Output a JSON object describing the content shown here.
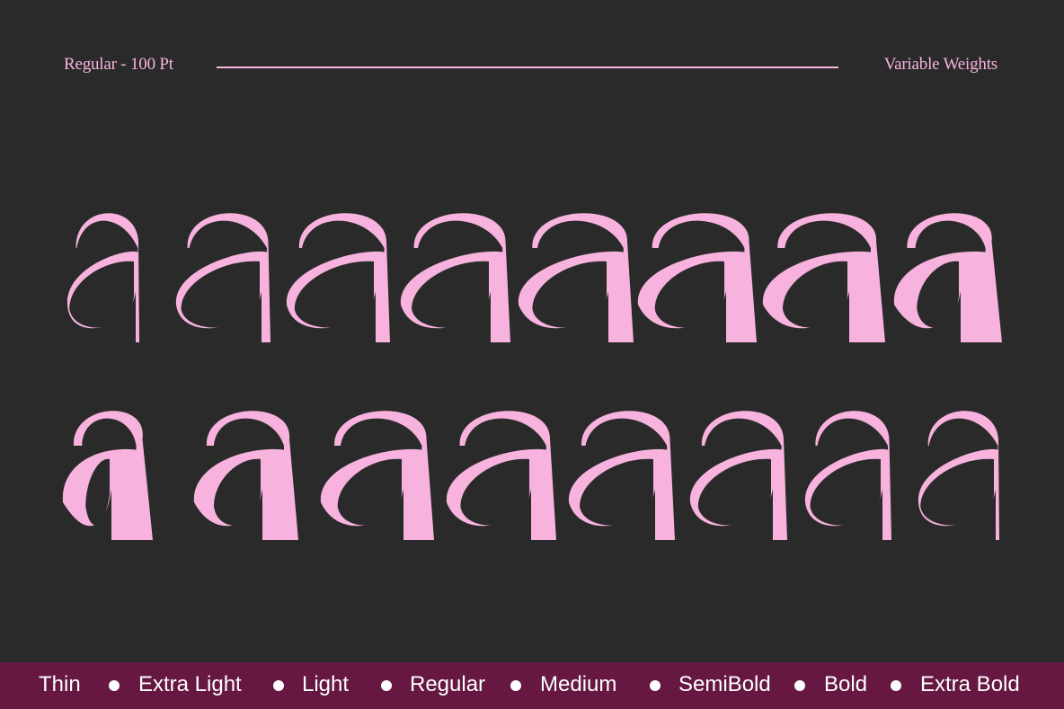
{
  "header": {
    "left_text": "Regular - 100 Pt",
    "right_text": "Variable Weights"
  },
  "specimen": {
    "glyph": "a",
    "color": "#f7b3de",
    "background": "#2b2a2b",
    "rows": [
      [
        "Thin",
        "Extra Light",
        "Light",
        "Regular",
        "Medium",
        "SemiBold",
        "Bold",
        "Extra Bold"
      ],
      [
        "Extra Bold",
        "Bold",
        "SemiBold",
        "Medium",
        "Regular",
        "Light",
        "Extra Light",
        "Thin"
      ]
    ]
  },
  "footer": {
    "bar_color": "#661842",
    "weights": [
      "Thin",
      "Extra Light",
      "Light",
      "Regular",
      "Medium",
      "SemiBold",
      "Bold",
      "Extra Bold"
    ]
  }
}
